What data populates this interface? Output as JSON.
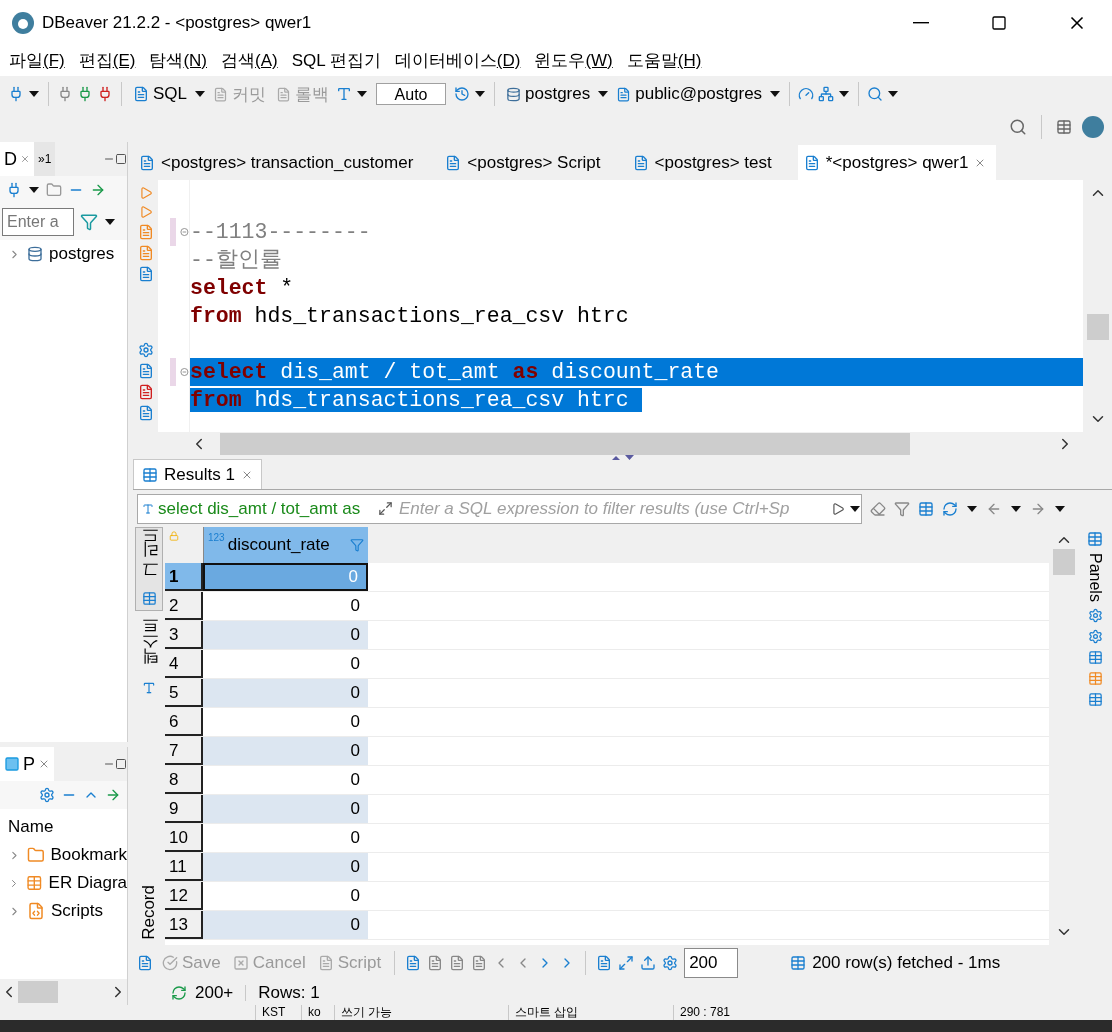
{
  "window": {
    "title": "DBeaver 21.2.2 - <postgres> qwer1"
  },
  "menu": [
    {
      "label": "파일",
      "mnemonic": "(F)"
    },
    {
      "label": "편집",
      "mnemonic": "(E)"
    },
    {
      "label": "탐색",
      "mnemonic": "(N)"
    },
    {
      "label": "검색",
      "mnemonic": "(A)"
    },
    {
      "label": "SQL 편집기"
    },
    {
      "label": "데이터베이스",
      "mnemonic": "(D)"
    },
    {
      "label": "윈도우",
      "mnemonic": "(W)"
    },
    {
      "label": "도움말",
      "mnemonic": "(H)"
    }
  ],
  "toolbar": {
    "sql": "SQL",
    "commit": {
      "label": "커밋",
      "disabled": true
    },
    "rollback": {
      "label": "롤백",
      "disabled": true
    },
    "transaction_mode": "Auto",
    "datasource": "postgres",
    "schema": "public@postgres"
  },
  "navigator": {
    "tabs": [
      {
        "label": "D",
        "selected": true
      },
      {
        "label": "»1",
        "selected": false
      }
    ],
    "filter": {
      "placeholder": "Enter a"
    },
    "tree": [
      {
        "label": "postgres",
        "expanded": false
      }
    ]
  },
  "projects": {
    "tab": "P",
    "column": "Name",
    "items": [
      {
        "label": "Bookmark",
        "kind": "bookmarks"
      },
      {
        "label": "ER Diagra",
        "kind": "diagrams"
      },
      {
        "label": "Scripts",
        "kind": "scripts"
      }
    ]
  },
  "editor": {
    "tabs": [
      {
        "label": "<postgres> transaction_customer",
        "selected": false
      },
      {
        "label": "<postgres> Script",
        "selected": false
      },
      {
        "label": "<postgres> test",
        "selected": false
      },
      {
        "label": "*<postgres> qwer1",
        "selected": true
      }
    ],
    "lines": [
      {
        "kind": "blank"
      },
      {
        "kind": "code",
        "fold": true,
        "selected": false,
        "tokens": [
          {
            "text": "--1113--------",
            "kind": "comment"
          }
        ]
      },
      {
        "kind": "code",
        "selected": false,
        "tokens": [
          {
            "text": "--할인률",
            "kind": "comment"
          }
        ]
      },
      {
        "kind": "code",
        "selected": false,
        "tokens": [
          {
            "text": "select",
            "kind": "keyword"
          },
          {
            "text": " *",
            "kind": "plain"
          }
        ]
      },
      {
        "kind": "code",
        "selected": false,
        "tokens": [
          {
            "text": "from",
            "kind": "keyword"
          },
          {
            "text": " hds_transactions_rea_csv htrc",
            "kind": "plain"
          }
        ]
      },
      {
        "kind": "blank"
      },
      {
        "kind": "code",
        "fold": true,
        "selected": true,
        "tokens": [
          {
            "text": "select",
            "kind": "keyword"
          },
          {
            "text": " dis_amt / tot_amt ",
            "kind": "plain"
          },
          {
            "text": "as",
            "kind": "keyword"
          },
          {
            "text": " discount_rate",
            "kind": "plain"
          }
        ]
      },
      {
        "kind": "code",
        "selected": true,
        "tokens": [
          {
            "text": "from",
            "kind": "keyword"
          },
          {
            "text": " hds_transactions_rea_csv htrc ",
            "kind": "plain"
          }
        ]
      }
    ]
  },
  "results": {
    "tab": "Results 1",
    "query": "select dis_amt / tot_amt as",
    "filter_placeholder": "Enter a SQL expression to filter results (use Ctrl+Sp",
    "column": {
      "type": "123",
      "name": "discount_rate"
    },
    "rows": [
      {
        "number": "1",
        "value": "0",
        "selected": true
      },
      {
        "number": "2",
        "value": "0",
        "selected": false
      },
      {
        "number": "3",
        "value": "0",
        "selected": false
      },
      {
        "number": "4",
        "value": "0",
        "selected": false
      },
      {
        "number": "5",
        "value": "0",
        "selected": false
      },
      {
        "number": "6",
        "value": "0",
        "selected": false
      },
      {
        "number": "7",
        "value": "0",
        "selected": false
      },
      {
        "number": "8",
        "value": "0",
        "selected": false
      },
      {
        "number": "9",
        "value": "0",
        "selected": false
      },
      {
        "number": "10",
        "value": "0",
        "selected": false
      },
      {
        "number": "11",
        "value": "0",
        "selected": false
      },
      {
        "number": "12",
        "value": "0",
        "selected": false
      },
      {
        "number": "13",
        "value": "0",
        "selected": false
      }
    ],
    "side_tabs": [
      {
        "label": "그리드",
        "selected": true
      },
      {
        "label": "텍스트",
        "selected": false
      }
    ],
    "record": "Record",
    "panels": "Panels",
    "actions": [
      {
        "label": "Save",
        "disabled": true
      },
      {
        "label": "Cancel",
        "disabled": true
      },
      {
        "label": "Script",
        "disabled": true
      }
    ],
    "fetch_size": "200",
    "fetched": "200 row(s) fetched - 1ms",
    "refresh_count": "200+",
    "rows_info": "Rows: 1"
  },
  "status_bar": [
    "KST",
    "ko",
    "쓰기 가능",
    "스마트 삽입",
    "290 : 781"
  ]
}
